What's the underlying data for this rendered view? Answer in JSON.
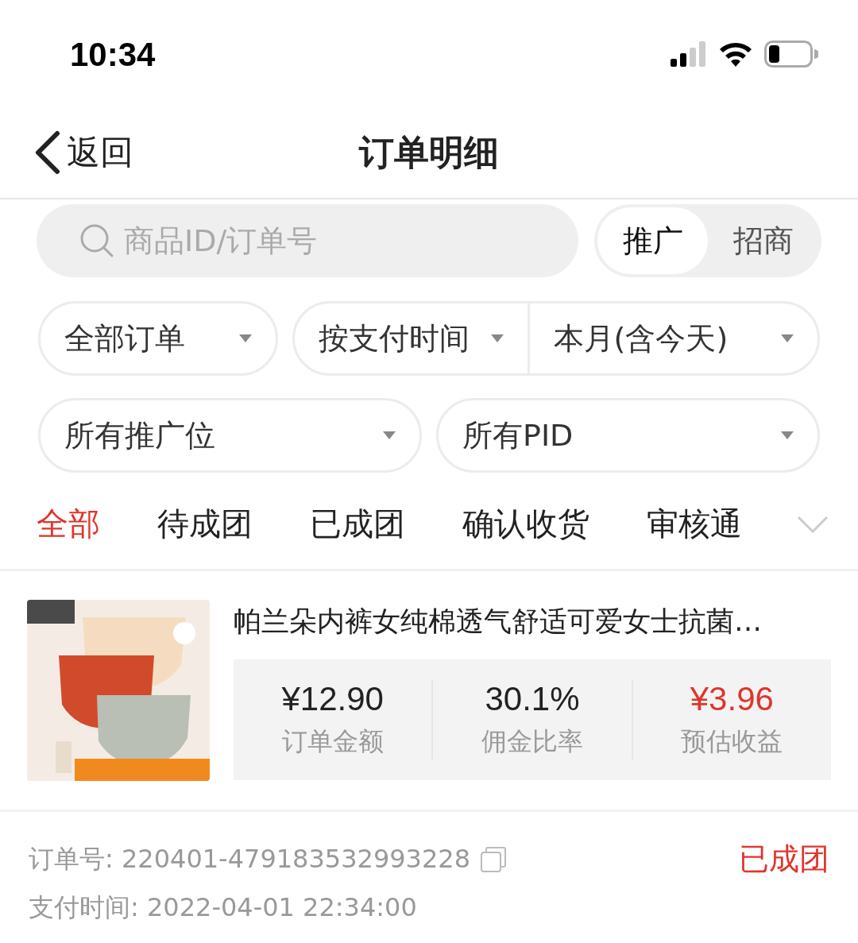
{
  "status_bar": {
    "time": "10:34"
  },
  "nav": {
    "back": "返回",
    "title": "订单明细"
  },
  "search": {
    "placeholder": "商品ID/订单号"
  },
  "mode_toggle": [
    {
      "label": "推广",
      "selected": true
    },
    {
      "label": "招商",
      "selected": false
    }
  ],
  "filter_rows": [
    [
      [
        "全部订单"
      ],
      [
        "按支付时间",
        "本月(含今天)"
      ]
    ],
    [
      [
        "所有推广位"
      ],
      [
        "所有PID"
      ]
    ]
  ],
  "tabs": [
    {
      "label": "全部",
      "selected": true
    },
    {
      "label": "待成团",
      "selected": false
    },
    {
      "label": "已成团",
      "selected": false
    },
    {
      "label": "确认收货",
      "selected": false
    },
    {
      "label": "审核通",
      "selected": false
    }
  ],
  "order": {
    "title": "帕兰朵内裤女纯棉透气舒适可爱女士抗菌…",
    "stats": [
      {
        "value": "¥12.90",
        "label": "订单金额",
        "kind": "plain"
      },
      {
        "value": "30.1%",
        "label": "佣金比率",
        "kind": "plain"
      },
      {
        "value": "¥3.96",
        "label": "预估收益",
        "kind": "highlight"
      }
    ],
    "order_no": "订单号: 220401-479183532993228",
    "status": "已成团",
    "pay_time": "支付时间: 2022-04-01 22:34:00"
  }
}
